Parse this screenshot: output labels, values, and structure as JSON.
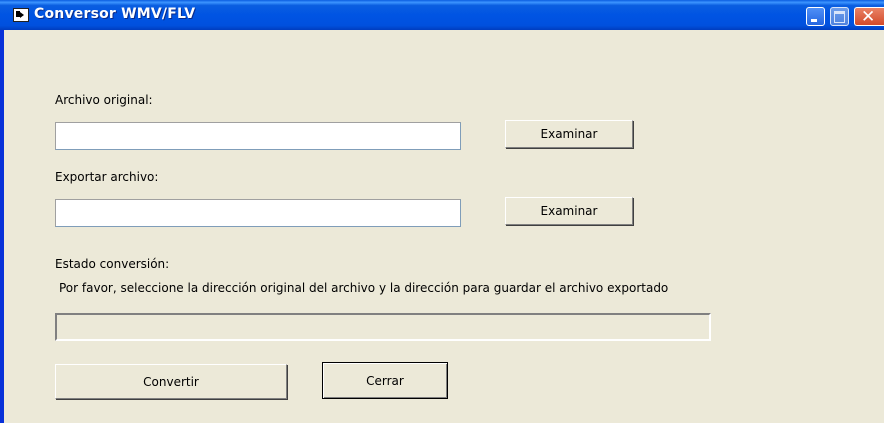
{
  "window": {
    "title": "Conversor WMV/FLV"
  },
  "form": {
    "source_label": "Archivo original:",
    "source_value": "",
    "browse_source_label": "Examinar",
    "export_label": "Exportar archivo:",
    "export_value": "",
    "browse_export_label": "Examinar",
    "status_label": "Estado conversión:",
    "status_message": "Por favor, seleccione la dirección original del archivo y la dirección para guardar el archivo exportado",
    "progress": 0,
    "convert_label": "Convertir",
    "close_label": "Cerrar"
  },
  "icons": [
    "app-icon",
    "minimize-icon",
    "maximize-icon",
    "close-icon"
  ],
  "colors": {
    "titlebar": "#0054e3",
    "window_bg": "#ece9d8",
    "close_button": "#d34a2a"
  }
}
